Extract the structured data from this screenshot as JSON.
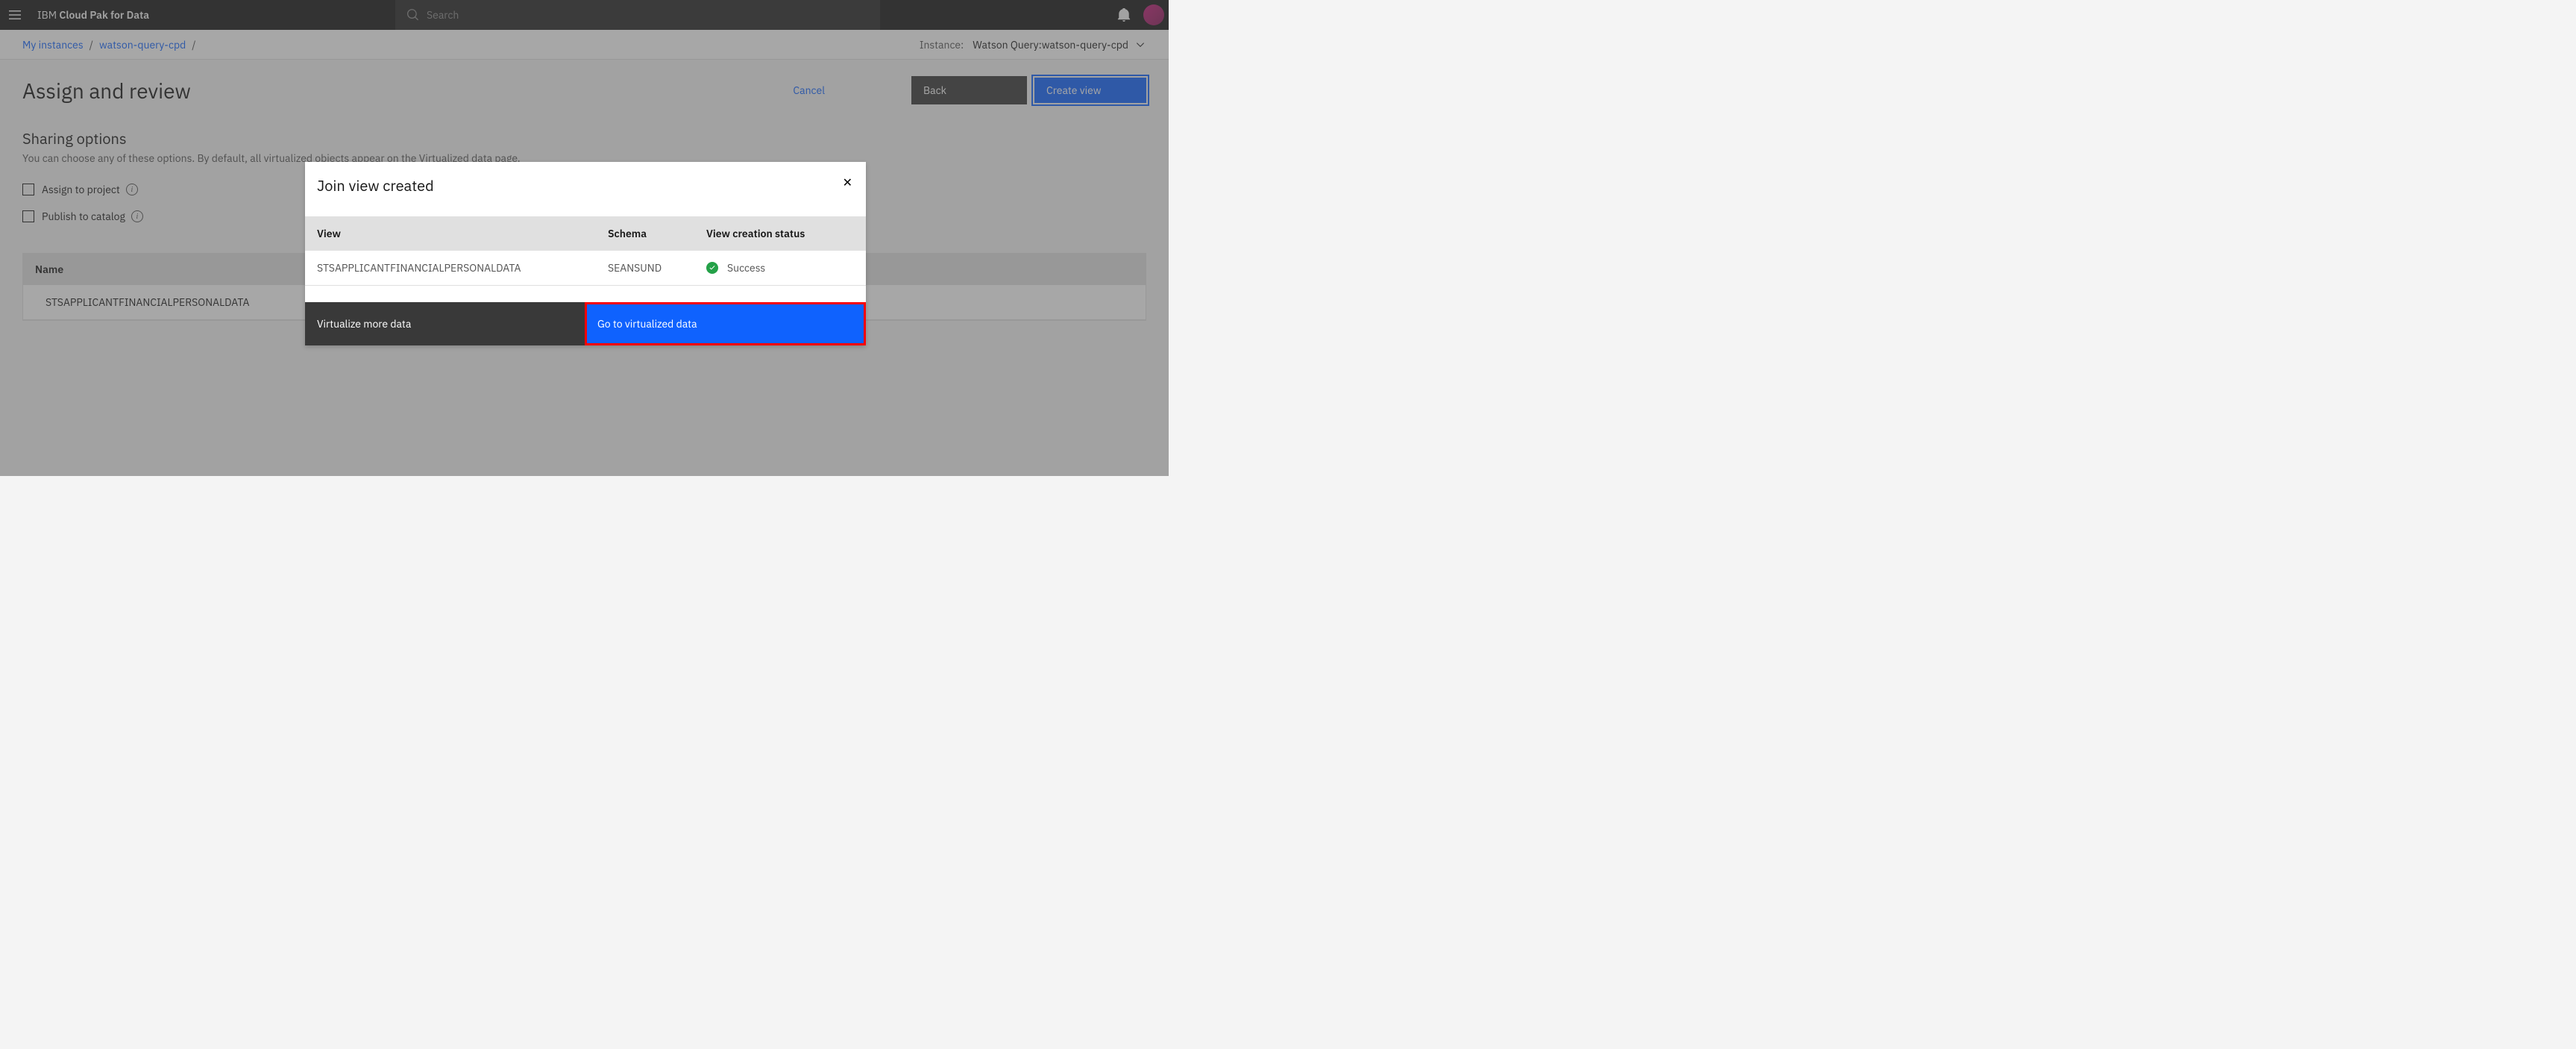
{
  "header": {
    "product_prefix": "IBM ",
    "product_name": "Cloud Pak for Data",
    "search_placeholder": "Search"
  },
  "breadcrumb": {
    "items": [
      "My instances",
      "watson-query-cpd"
    ],
    "instance_label": "Instance:",
    "instance_value": "Watson Query:watson-query-cpd"
  },
  "page": {
    "title": "Assign and review",
    "cancel": "Cancel",
    "back": "Back",
    "create": "Create view"
  },
  "sharing": {
    "title": "Sharing options",
    "desc": "You can choose any of these options. By default, all virtualized objects appear on the Virtualized data page.",
    "assign_project": "Assign to project",
    "publish_catalog": "Publish to catalog"
  },
  "table": {
    "col_name": "Name",
    "rows": [
      "STSAPPLICANTFINANCIALPERSONALDATA"
    ]
  },
  "modal": {
    "title": "Join view created",
    "columns": {
      "view": "View",
      "schema": "Schema",
      "status": "View creation status"
    },
    "rows": [
      {
        "view": "STSAPPLICANTFINANCIALPERSONALDATA",
        "schema": "SEANSUND",
        "status": "Success"
      }
    ],
    "btn_more": "Virtualize more data",
    "btn_go": "Go to virtualized data"
  }
}
